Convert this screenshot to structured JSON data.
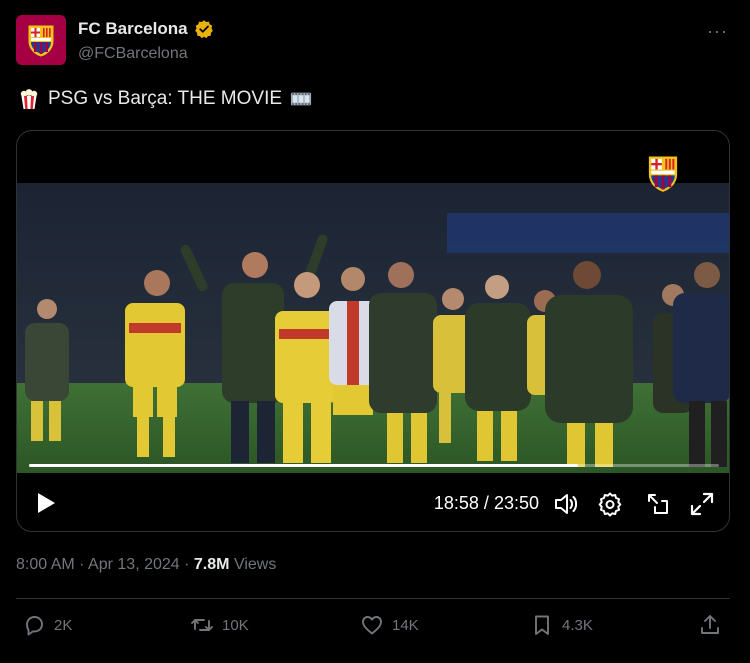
{
  "account": {
    "name": "FC Barcelona",
    "handle": "@FCBarcelona",
    "avatar_color": "#a50044",
    "verified_color": "#e8b10c",
    "more_label": "···"
  },
  "tweet": {
    "emoji_start": "popcorn-icon",
    "text": "PSG vs Barça: THE MOVIE",
    "emoji_end": "film-frames-icon"
  },
  "video": {
    "current_time": "18:58",
    "separator": "/",
    "duration": "23:50",
    "progress_fraction": 0.796,
    "controls": [
      "play-icon",
      "volume-icon",
      "settings-icon",
      "pip-icon",
      "fullscreen-icon"
    ]
  },
  "meta": {
    "time": "8:00 AM",
    "dot": "·",
    "date": "Apr 13, 2024",
    "views_count": "7.8M",
    "views_label": "Views"
  },
  "actions": {
    "replies": "2K",
    "reposts": "10K",
    "likes": "14K",
    "bookmarks": "4.3K"
  },
  "colors": {
    "background": "#000000",
    "text": "#e7e9ea",
    "muted": "#71767b",
    "border": "#2f3336"
  }
}
